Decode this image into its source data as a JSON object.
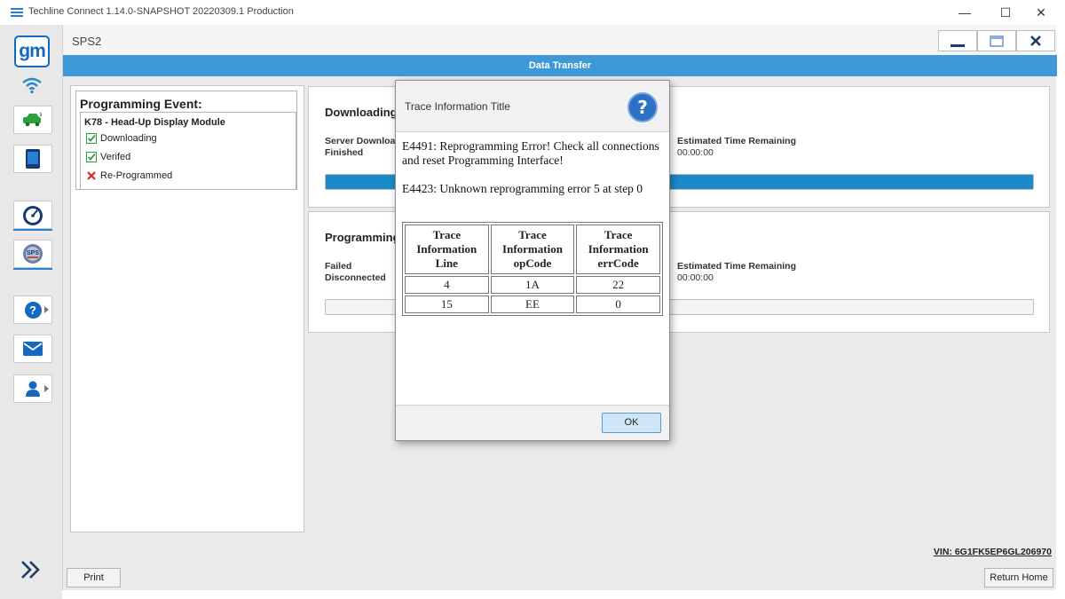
{
  "window": {
    "title": "Techline Connect 1.14.0-SNAPSHOT 20220309.1 Production",
    "minimize": "—",
    "maximize": "☐",
    "close": "✕"
  },
  "sidebar": {
    "logo_text": "gm",
    "items": [
      {
        "icon": "wifi-icon"
      },
      {
        "icon": "vehicle-icon"
      },
      {
        "icon": "device-icon"
      },
      {
        "icon": "gauge-icon"
      },
      {
        "icon": "sps-icon",
        "label": "SPS"
      },
      {
        "icon": "help-icon",
        "label": "?"
      },
      {
        "icon": "mail-icon"
      },
      {
        "icon": "user-icon"
      }
    ],
    "expand_icon": "double-chevron-right-icon"
  },
  "header": {
    "title": "SPS2",
    "banner": "Data Transfer"
  },
  "programming_event": {
    "heading": "Programming Event:",
    "module": "K78 - Head-Up Display Module",
    "steps": [
      {
        "label": "Downloading",
        "status": "done"
      },
      {
        "label": "Verifed",
        "status": "done"
      },
      {
        "label": "Re-Programmed",
        "status": "failed"
      }
    ]
  },
  "downloading_panel": {
    "title": "Downloading",
    "left_line1": "Server Download",
    "left_line2": "Finished",
    "right_label": "Estimated Time Remaining",
    "right_value": "00:00:00",
    "progress": 1.0
  },
  "programming_panel": {
    "title": "Programming",
    "left_line1": "Failed",
    "left_line2": "Disconnected",
    "right_label": "Estimated Time Remaining",
    "right_value": "00:00:00",
    "progress": 0.0
  },
  "vin": "VIN: 6G1FK5EP6GL206970",
  "buttons": {
    "print": "Print",
    "return_home": "Return Home"
  },
  "dialog": {
    "title": "Trace Information Title",
    "help_glyph": "?",
    "message1": "E4491: Reprogramming Error! Check all connections and reset Programming Interface!",
    "message2": "E4423: Unknown reprogramming error 5 at step 0",
    "table": {
      "headers": [
        [
          "Trace",
          "Information",
          "Line"
        ],
        [
          "Trace",
          "Information",
          "opCode"
        ],
        [
          "Trace",
          "Information",
          "errCode"
        ]
      ],
      "rows": [
        [
          "4",
          "1A",
          "22"
        ],
        [
          "15",
          "EE",
          "0"
        ]
      ]
    },
    "ok_label": "OK"
  },
  "colors": {
    "accent": "#3d9ad6",
    "progress": "#1a8ac8",
    "success": "#2e9e3e",
    "error": "#d42a1f",
    "gm_blue": "#1268c3"
  }
}
